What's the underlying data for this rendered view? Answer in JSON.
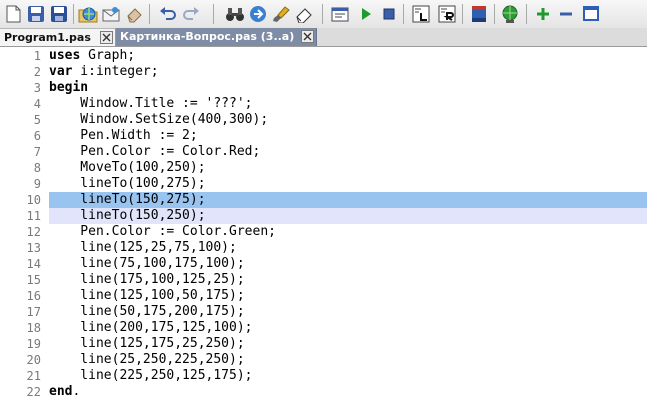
{
  "window": {
    "tabs": [
      {
        "label": "Program1.pas",
        "active": true
      },
      {
        "label": "Картинка-Вопрос.pas (3..a)",
        "active": false
      }
    ]
  },
  "toolbar": {
    "buttons": [
      {
        "name": "new-file",
        "icon": "new-file-icon"
      },
      {
        "name": "save",
        "icon": "save-icon"
      },
      {
        "name": "save-all",
        "icon": "save-all-icon"
      },
      {
        "name": "open-web",
        "icon": "globe-folder-icon"
      },
      {
        "name": "email",
        "icon": "envelope-icon"
      },
      {
        "name": "clear",
        "icon": "eraser-icon"
      },
      {
        "name": "undo",
        "icon": "undo-icon"
      },
      {
        "name": "redo",
        "icon": "redo-icon"
      },
      {
        "name": "find",
        "icon": "binoculars-icon"
      },
      {
        "name": "goto",
        "icon": "goto-icon"
      },
      {
        "name": "format",
        "icon": "brush-icon"
      },
      {
        "name": "erase",
        "icon": "rubber-icon"
      },
      {
        "name": "compile",
        "icon": "compile-icon"
      },
      {
        "name": "run",
        "icon": "play-icon"
      },
      {
        "name": "stop",
        "icon": "stop-icon"
      },
      {
        "name": "input-window",
        "icon": "input-window-icon"
      },
      {
        "name": "output-window",
        "icon": "output-window-icon"
      },
      {
        "name": "database",
        "icon": "books-icon"
      },
      {
        "name": "network",
        "icon": "network-icon"
      },
      {
        "name": "add",
        "icon": "plus-icon"
      },
      {
        "name": "remove",
        "icon": "minus-icon"
      },
      {
        "name": "window",
        "icon": "window-icon"
      }
    ]
  },
  "editor": {
    "line_numbers": [
      "1",
      "2",
      "3",
      "4",
      "5",
      "6",
      "7",
      "8",
      "9",
      "10",
      "11",
      "12",
      "13",
      "14",
      "15",
      "16",
      "17",
      "18",
      "19",
      "20",
      "21",
      "22"
    ],
    "lines": [
      {
        "kw": "uses",
        "rest": " Graph;"
      },
      {
        "kw": "var",
        "rest": " i:integer;"
      },
      {
        "kw": "begin",
        "rest": ""
      },
      {
        "kw": "",
        "rest": "    Window.Title := '???';"
      },
      {
        "kw": "",
        "rest": "    Window.SetSize(400,300);"
      },
      {
        "kw": "",
        "rest": "    Pen.Width := 2;"
      },
      {
        "kw": "",
        "rest": "    Pen.Color := Color.Red;"
      },
      {
        "kw": "",
        "rest": "    MoveTo(100,250);"
      },
      {
        "kw": "",
        "rest": "    lineTo(100,275);"
      },
      {
        "kw": "",
        "rest": "    lineTo(150,275);"
      },
      {
        "kw": "",
        "rest": "    lineTo(150,250);"
      },
      {
        "kw": "",
        "rest": "    Pen.Color := Color.Green;"
      },
      {
        "kw": "",
        "rest": "    line(125,25,75,100);"
      },
      {
        "kw": "",
        "rest": "    line(75,100,175,100);"
      },
      {
        "kw": "",
        "rest": "    line(175,100,125,25);"
      },
      {
        "kw": "",
        "rest": "    line(125,100,50,175);"
      },
      {
        "kw": "",
        "rest": "    line(50,175,200,175);"
      },
      {
        "kw": "",
        "rest": "    line(200,175,125,100);"
      },
      {
        "kw": "",
        "rest": "    line(125,175,25,250);"
      },
      {
        "kw": "",
        "rest": "    line(25,250,225,250);"
      },
      {
        "kw": "",
        "rest": "    line(225,250,125,175);"
      },
      {
        "kw": "end",
        "rest": "."
      }
    ],
    "highlight_colors": {
      "current": "#99c4f0",
      "selected": "#e1e4fa"
    }
  }
}
